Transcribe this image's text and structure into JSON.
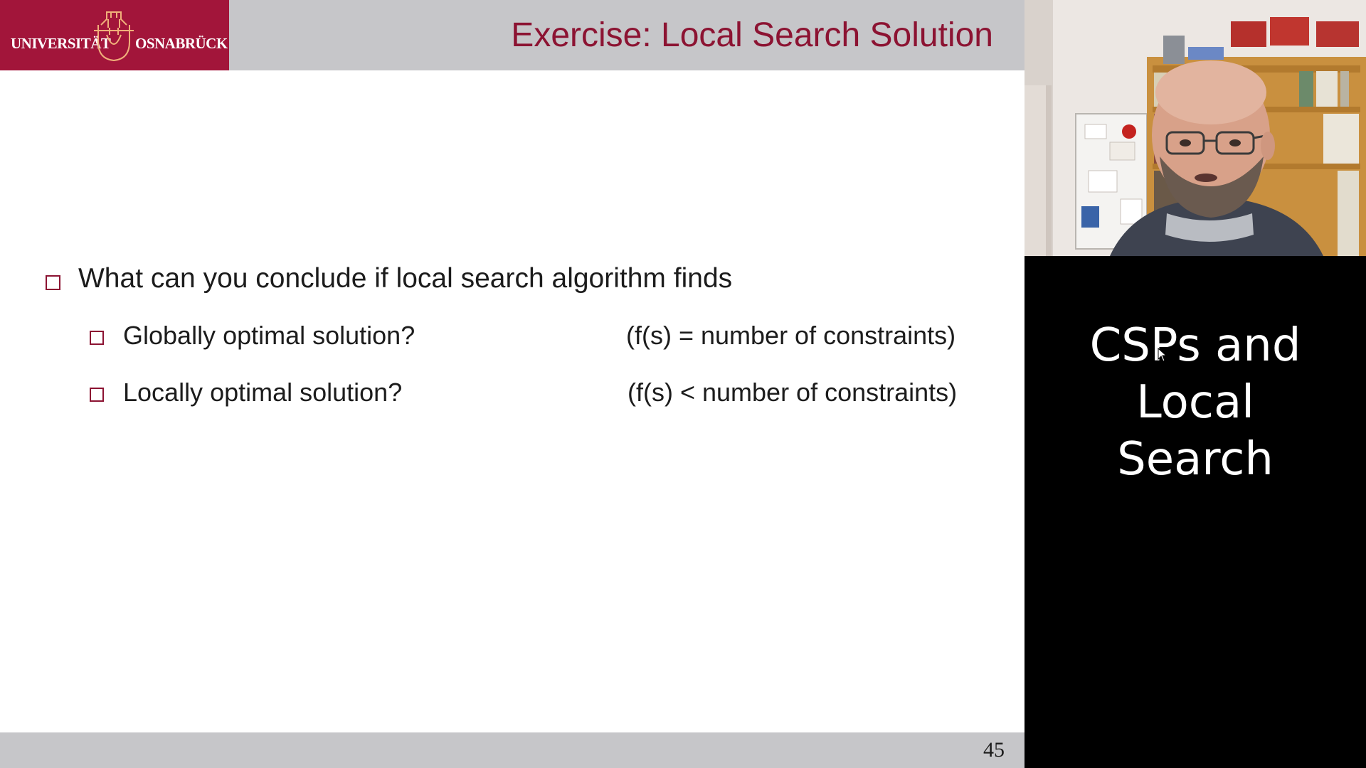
{
  "slide": {
    "logo": {
      "left_word": "UNIVERSITÄT",
      "right_word": "OSNABRÜCK",
      "brand_color": "#a2153a"
    },
    "title": "Exercise: Local Search Solution",
    "title_color": "#8c1332",
    "question": "What can you conclude if local search algorithm finds",
    "sub_items": [
      {
        "label": "Globally optimal solution?",
        "formula": "(f(s) = number of constraints)"
      },
      {
        "label": "Locally optimal solution?",
        "formula": "(f(s) < number of constraints)"
      }
    ],
    "page_number": "45",
    "bar_color": "#c6c6c9"
  },
  "side_panel": {
    "caption_lines": [
      "CSPs and",
      "Local",
      "Search"
    ],
    "webcam": {
      "description_icon": "webcam-video-icon"
    }
  }
}
